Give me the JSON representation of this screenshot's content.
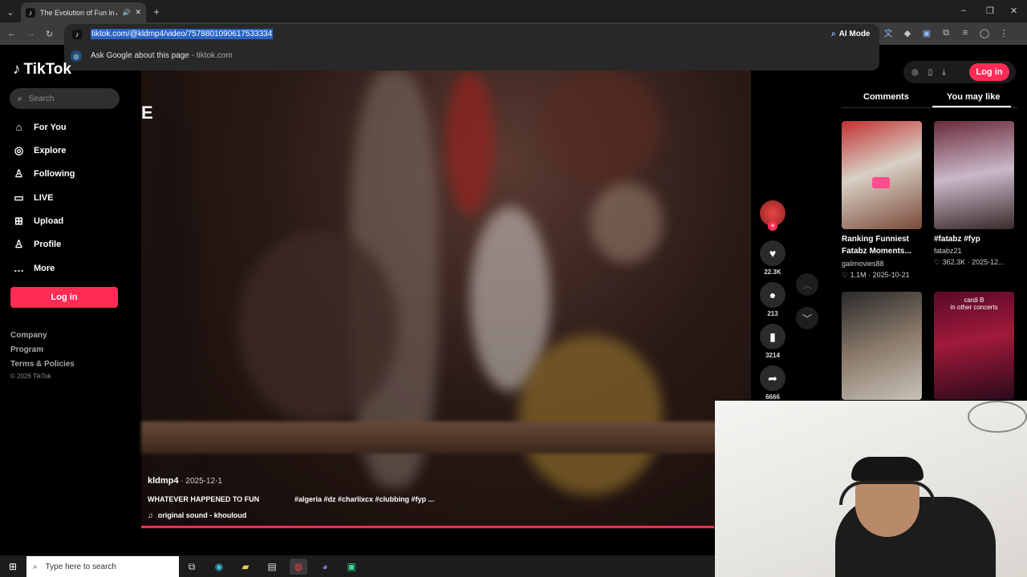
{
  "browser": {
    "tab_title": "The Evolution of Fun in Alg",
    "url": "tiktok.com/@kldmp4/video/7578801090617533334",
    "suggestion_text": "Ask Google about this page",
    "suggestion_domain": "tiktok.com",
    "ai_mode_label": "AI Mode"
  },
  "sidebar": {
    "logo": "TikTok",
    "search_placeholder": "Search",
    "items": [
      {
        "label": "For You",
        "icon": "home-icon"
      },
      {
        "label": "Explore",
        "icon": "compass-icon"
      },
      {
        "label": "Following",
        "icon": "following-icon"
      },
      {
        "label": "LIVE",
        "icon": "live-icon"
      },
      {
        "label": "Upload",
        "icon": "upload-icon"
      },
      {
        "label": "Profile",
        "icon": "profile-icon"
      },
      {
        "label": "More",
        "icon": "more-icon"
      }
    ],
    "login_label": "Log in",
    "footer": [
      "Company",
      "Program",
      "Terms & Policies"
    ],
    "copyright": "© 2026 TikTok"
  },
  "video": {
    "overlay_letter": "E",
    "author": "kldmp4",
    "date": "2025-12-1",
    "caption": "WHATEVER HAPPENED TO FUN",
    "tags": "#algeria #dz #charlixcx #clubbing #fyp ...",
    "sound": "original sound - khouloud",
    "progress": 0.94
  },
  "actions": {
    "likes": "22.3K",
    "comments": "213",
    "saves": "3214",
    "shares": "6666"
  },
  "right": {
    "login_label": "Log in",
    "tabs": [
      "Comments",
      "You may like"
    ],
    "active_tab": "You may like",
    "cards": [
      {
        "title1": "Ranking Funniest",
        "title2": "Fatabz Moments...",
        "author": "galimovies88",
        "meta": "♡ 1.1M · 2025-10-21"
      },
      {
        "title1": "#fatabz #fyp",
        "title2": "",
        "author": "fatabz21",
        "meta": "♡ 362.3K · 2025-12..."
      },
      {
        "overlay": "cardi B\nin other concerts"
      }
    ]
  },
  "taskbar": {
    "search_placeholder": "Type here to search"
  }
}
